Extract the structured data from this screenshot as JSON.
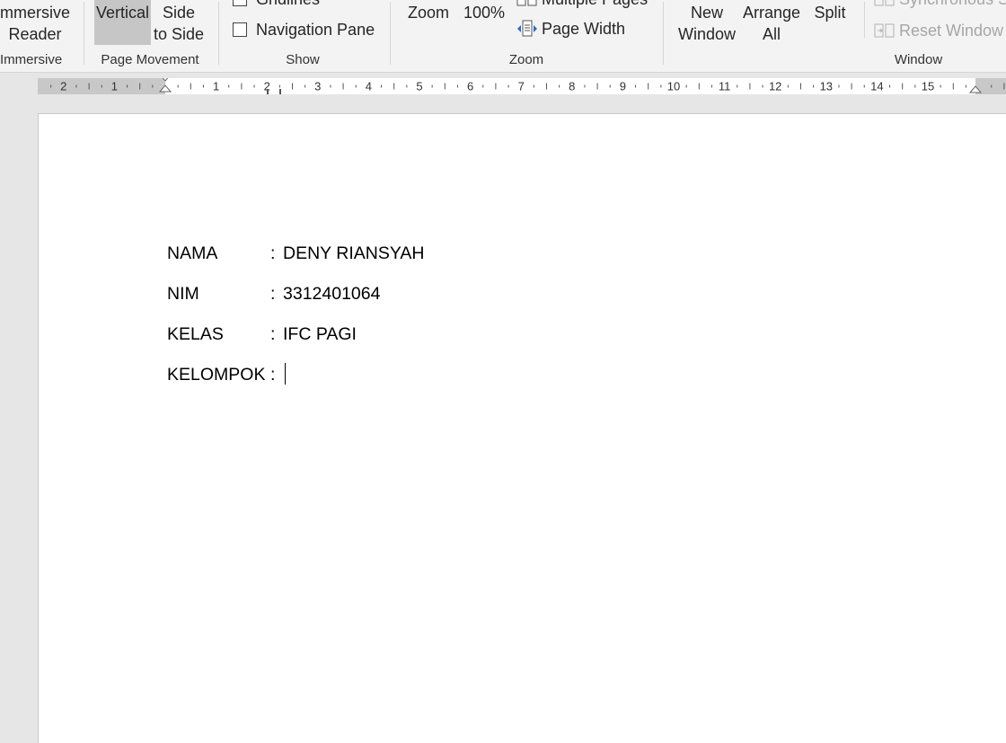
{
  "ribbon": {
    "immersive": {
      "reader_line1": "mmersive",
      "reader_line2": "Reader",
      "group_label": "Immersive"
    },
    "page_movement": {
      "vertical": "Vertical",
      "side_line1": "Side",
      "side_line2": "to Side",
      "group_label": "Page Movement"
    },
    "show": {
      "gridlines": "Gridlines",
      "navigation_pane": "Navigation Pane",
      "group_label": "Show"
    },
    "zoom": {
      "zoom": "Zoom",
      "hundred": "100%",
      "multiple_pages": "Multiple Pages",
      "page_width": "Page Width",
      "group_label": "Zoom"
    },
    "window": {
      "new_line1": "New",
      "new_line2": "Window",
      "arrange_line1": "Arrange",
      "arrange_line2": "All",
      "split": "Split",
      "synchronous": "Synchronous Scrolling",
      "reset_window": "Reset Window",
      "group_label": "Window"
    }
  },
  "ruler": {
    "left_labels": [
      "2",
      "1"
    ],
    "right_labels": [
      "1",
      "2",
      "3",
      "4",
      "5",
      "6",
      "7",
      "8",
      "9",
      "10",
      "11",
      "12",
      "13",
      "14",
      "15"
    ]
  },
  "document": {
    "rows": [
      {
        "label": "NAMA",
        "colon": ":",
        "value": "DENY RIANSYAH"
      },
      {
        "label": "NIM",
        "colon": ":",
        "value": "3312401064"
      },
      {
        "label": "KELAS",
        "colon": ":",
        "value": "IFC PAGI"
      },
      {
        "label": "KELOMPOK",
        "colon": ":",
        "value": ""
      }
    ]
  }
}
